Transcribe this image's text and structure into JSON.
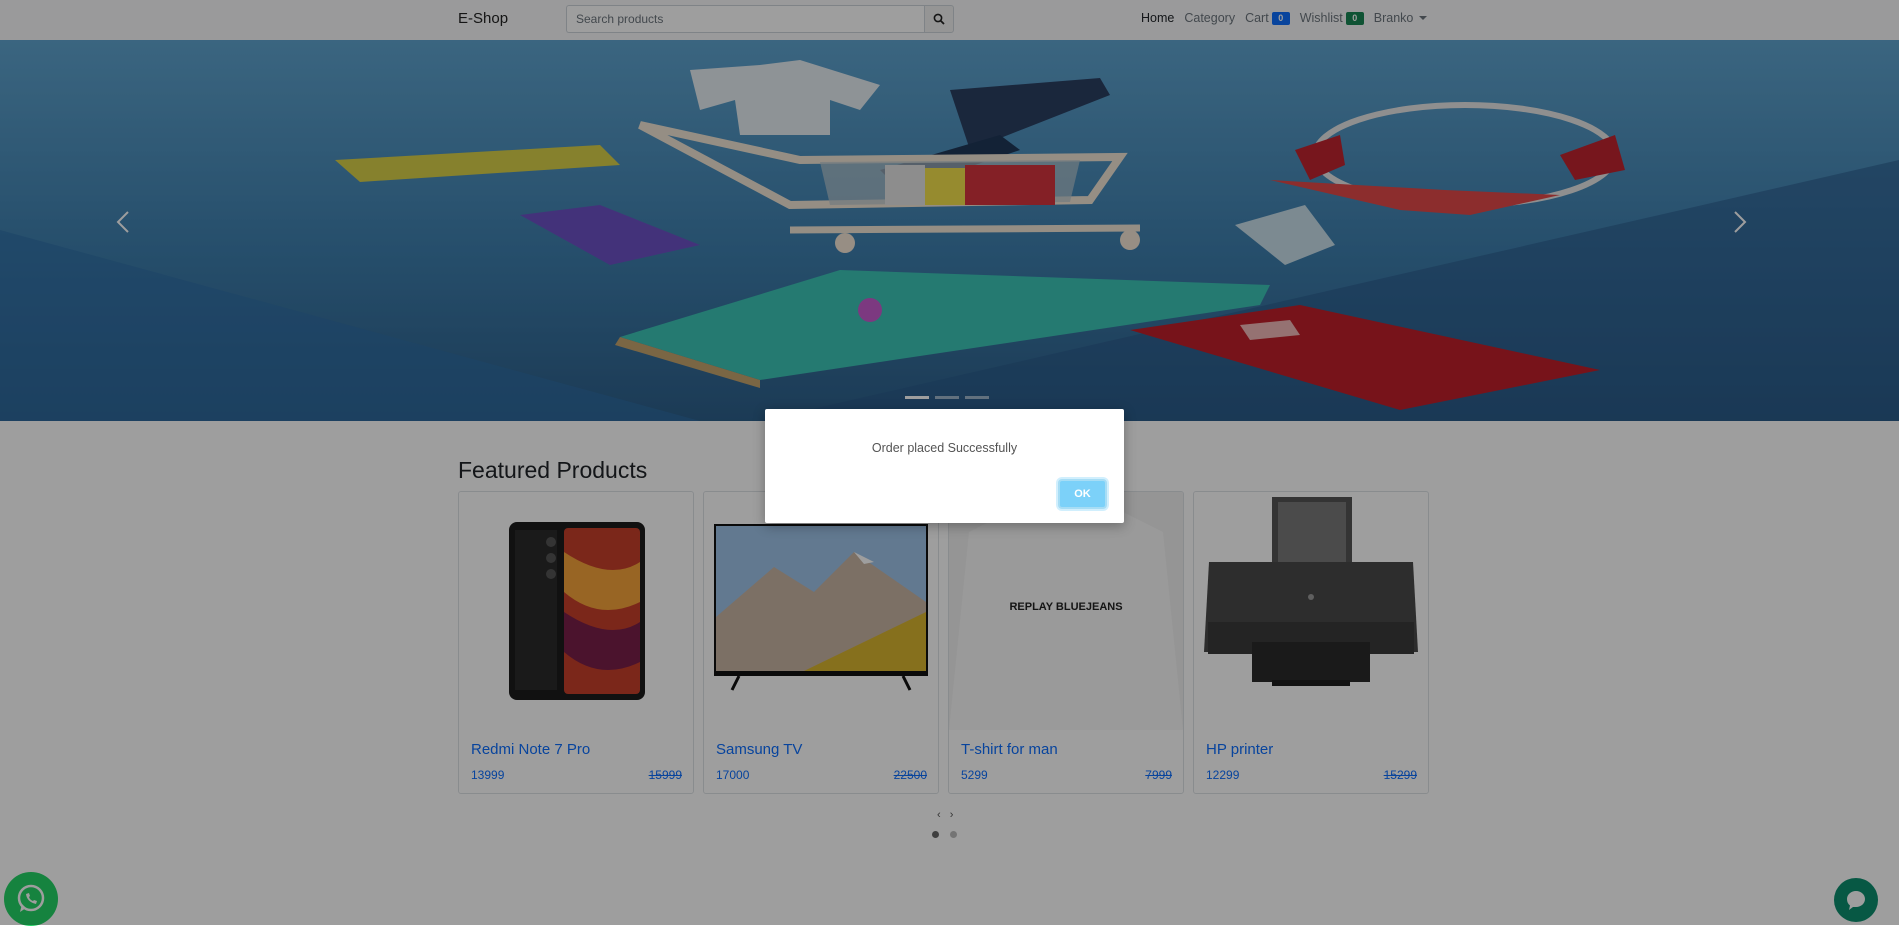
{
  "navbar": {
    "brand": "E-Shop",
    "search_placeholder": "Search products",
    "links": {
      "home": "Home",
      "category": "Category",
      "cart": "Cart",
      "cart_count": "0",
      "wishlist": "Wishlist",
      "wishlist_count": "0",
      "user": "Branko"
    }
  },
  "hero": {
    "slide_count": 3,
    "active_slide": 1
  },
  "featured": {
    "title": "Featured Products",
    "products": [
      {
        "name": "Redmi Note 7 Pro",
        "price": "13999",
        "old_price": "15999"
      },
      {
        "name": "Samsung TV",
        "price": "17000",
        "old_price": "22500"
      },
      {
        "name": "T-shirt for man",
        "price": "5299",
        "old_price": "7999",
        "shirt_text": "REPLAY BLUEJEANS"
      },
      {
        "name": "HP printer",
        "price": "12299",
        "old_price": "15299"
      }
    ],
    "nav_arrows": "‹ ›",
    "pages": 2,
    "active_page": 1
  },
  "modal": {
    "message": "Order placed Successfully",
    "ok_label": "OK"
  },
  "colors": {
    "link": "#0d6efd",
    "cart_badge": "#0d6efd",
    "wishlist_badge": "#198754",
    "ok_button": "#7cd1f9",
    "whatsapp": "#25d366",
    "chat": "#0c8f6f"
  }
}
